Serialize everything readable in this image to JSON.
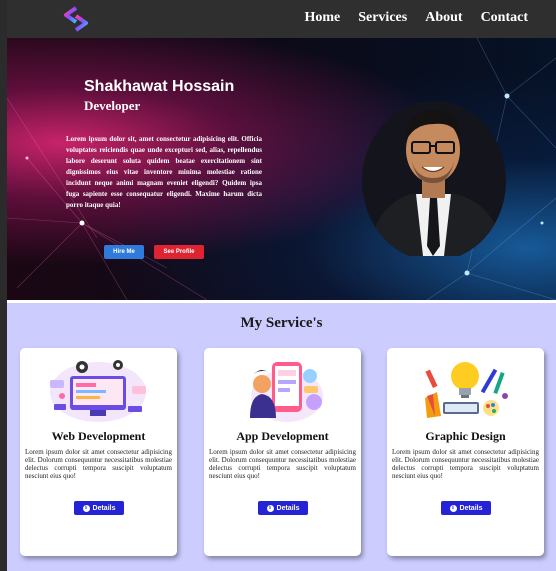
{
  "nav": {
    "logo_icon": "gradient-s-logo-icon",
    "links": [
      "Home",
      "Services",
      "About",
      "Contact"
    ]
  },
  "hero": {
    "name": "Shakhawat Hossain",
    "role": "Developer",
    "bio": "Lorem ipsum dolor sit, amet consectetur adipisicing elit. Officia voluptates reiciendis quae unde excepturi sed, alias, repellendus labore deserunt soluta quidem beatae exercitationem sint dignissimos eius vitae inventore minima molestiae ratione incidunt neque animi magnam eveniet eligendi? Quidem ipsa fuga sapiente esse consequatur eligendi. Maxime harum dicta porro itaque quia!",
    "hire_label": "Hire Me",
    "profile_label": "See Profile",
    "colors": {
      "hire": "#2e7bdc",
      "profile": "#e02330"
    }
  },
  "services": {
    "title": "My Service's",
    "cards": [
      {
        "title": "Web Development",
        "text": "Lorem ipsum dolor sit amet consectetur adipisicing elit. Dolorum consequuntur necessitatibus molestiae delectus corrupti tempora suscipit voluptatum nesciunt eius quo!",
        "button": "Details",
        "icon": "web-development-illustration"
      },
      {
        "title": "App Development",
        "text": "Lorem ipsum dolor sit amet consectetur adipisicing elit. Dolorum consequuntur necessitatibus molestiae delectus corrupti tempora suscipit voluptatum nesciunt eius quo!",
        "button": "Details",
        "icon": "app-development-illustration"
      },
      {
        "title": "Graphic Design",
        "text": "Lorem ipsum dolor sit amet consectetur adipisicing elit. Dolorum consequuntur necessitatibus molestiae delectus corrupti tempora suscipit voluptatum nesciunt eius quo!",
        "button": "Details",
        "icon": "graphic-design-illustration"
      }
    ],
    "colors": {
      "button": "#2424d6",
      "background": "#ccccff"
    }
  }
}
